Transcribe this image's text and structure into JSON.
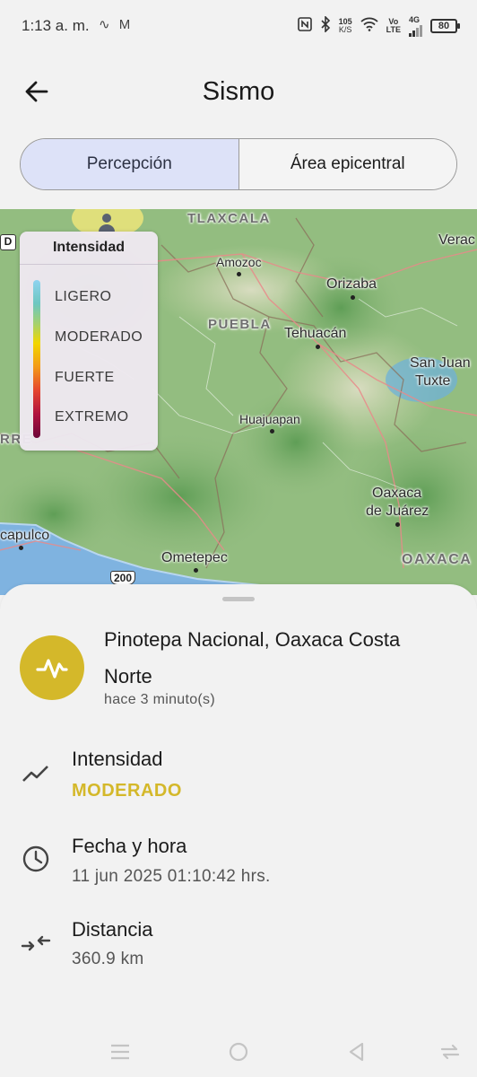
{
  "status_bar": {
    "time": "1:13 a. m.",
    "left_icons": [
      "activity-icon",
      "gmail-icon"
    ],
    "network_speed_value": "105",
    "network_speed_unit": "K/S",
    "volte_top": "Vo",
    "volte_bottom": "LTE",
    "network_type": "4G",
    "battery": "80"
  },
  "header": {
    "title": "Sismo",
    "back_icon": "arrow-left-icon"
  },
  "tabs": [
    {
      "label": "Percepción",
      "active": true
    },
    {
      "label": "Área epicentral",
      "active": false
    }
  ],
  "map": {
    "places": {
      "tlaxcala": "TLAXCALA",
      "amozoc": "Amozoc",
      "veracruz": "Verac",
      "orizaba": "Orizaba",
      "puebla": "PUEBLA",
      "tehuacan": "Tehuacán",
      "san_juan": "San Juan",
      "tuxtepec": "Tuxte",
      "huajuapan": "Huajuapan",
      "oaxaca_1": "Oaxaca",
      "oaxaca_2": "de Juárez",
      "acapulco": "capulco",
      "ometepec": "Ometepec",
      "oaxaca_state": "OAXACA",
      "guerrero_cut": "RRE",
      "highway_shield": "200",
      "edge_tag": "D"
    },
    "legend": {
      "title": "Intensidad",
      "levels": [
        "LIGERO",
        "MODERADO",
        "FUERTE",
        "EXTREMO"
      ],
      "gradient_colors": [
        "#8fd3f0",
        "#6dc7c0",
        "#a6d16a",
        "#f2d600",
        "#f39a18",
        "#e5452e",
        "#b0123f",
        "#6c0638"
      ]
    }
  },
  "event": {
    "location": "Pinotepa Nacional, Oaxaca Costa Norte",
    "relative_time": "hace 3 minuto(s)",
    "badge_color": "#d4b82a",
    "badge_icon": "seismic-wave-icon",
    "details": {
      "intensity_label": "Intensidad",
      "intensity_value": "MODERADO",
      "intensity_icon": "trend-line-icon",
      "datetime_label": "Fecha y hora",
      "datetime_value": "11 jun 2025 01:10:42 hrs.",
      "datetime_icon": "clock-icon",
      "distance_label": "Distancia",
      "distance_value": "360.9 km",
      "distance_icon": "arrows-converge-icon"
    }
  },
  "nav_bar": [
    "menu-icon",
    "home-icon",
    "back-triangle-icon",
    "rotate-icon"
  ]
}
